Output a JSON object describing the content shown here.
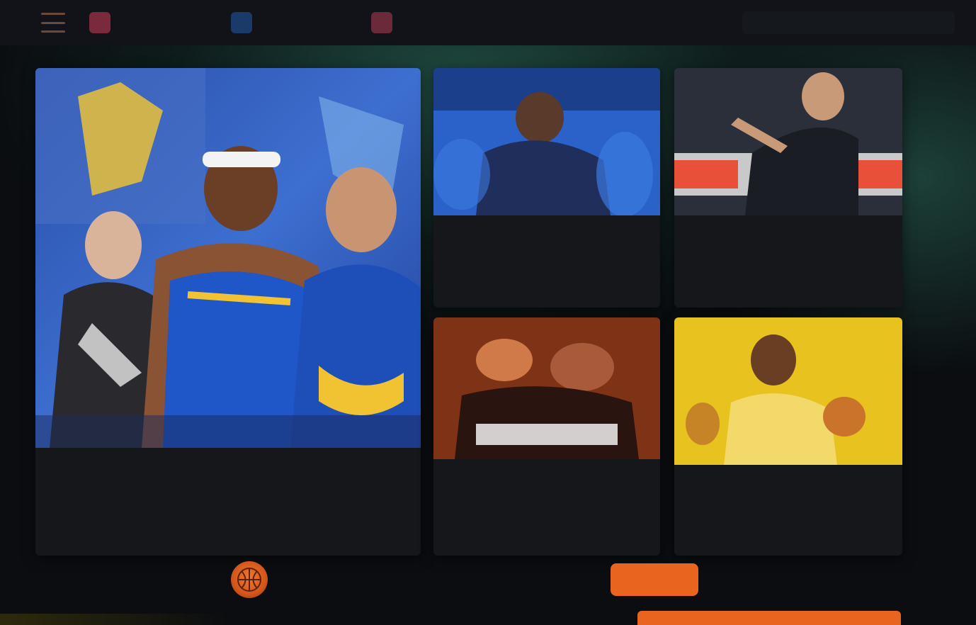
{
  "topbar": {
    "menu_icon": "hamburger-icon",
    "tabs": [
      {
        "label": "",
        "logo_text": "",
        "logo_color": "#7a2a3a"
      },
      {
        "label": "",
        "logo_text": "",
        "logo_color": "#1a3a6a"
      },
      {
        "label": "",
        "logo_text": "",
        "logo_color": "#6a2a3a"
      }
    ],
    "account_text": ""
  },
  "feature": {
    "tag": "",
    "headline": "",
    "meta": [
      "",
      ""
    ]
  },
  "cards": [
    {
      "headline": "",
      "meta": [
        "",
        ""
      ]
    },
    {
      "headline": "",
      "meta": [
        "",
        ""
      ]
    },
    {
      "headline": "",
      "meta": [
        "",
        ""
      ]
    },
    {
      "headline": "",
      "meta": [
        "",
        ""
      ]
    }
  ],
  "promo": {
    "icon": "basketball-icon",
    "title": "",
    "subtitle": "",
    "button_label": ""
  },
  "colors": {
    "accent": "#e8641f",
    "tag_red": "#e0462f",
    "background": "#0b0d10",
    "card": "#15171b"
  }
}
